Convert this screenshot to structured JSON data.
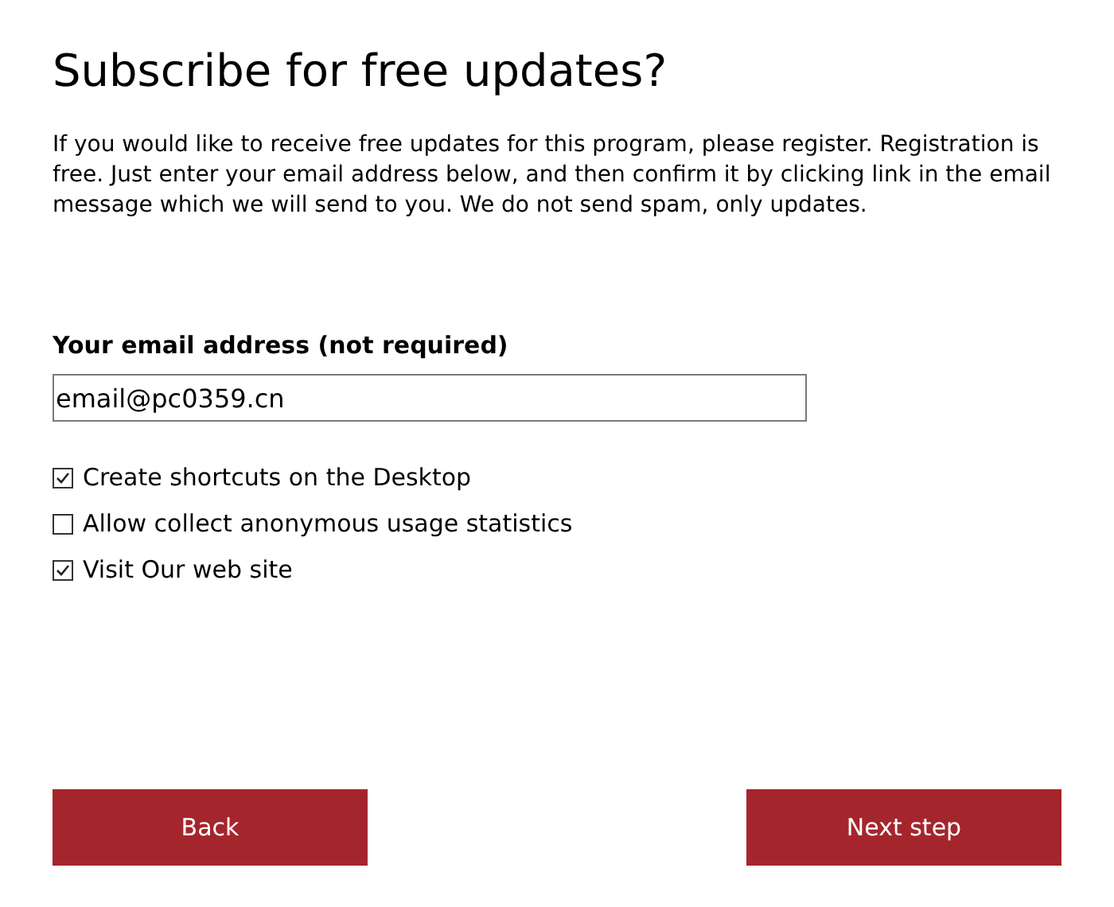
{
  "title": "Subscribe for free updates?",
  "description": "If you would like to receive free updates for this program, please register. Registration is free. Just enter your email address below, and then confirm it by clicking link in the email message which we will send to you. We do not send spam, only updates.",
  "email": {
    "label": "Your email address (not required)",
    "value": "email@pc0359.cn"
  },
  "options": [
    {
      "label": "Create shortcuts on the Desktop",
      "checked": true
    },
    {
      "label": "Allow collect anonymous usage statistics",
      "checked": false
    },
    {
      "label": "Visit Our web site",
      "checked": true
    }
  ],
  "buttons": [
    {
      "label": "Back"
    },
    {
      "label": "Next step"
    }
  ]
}
